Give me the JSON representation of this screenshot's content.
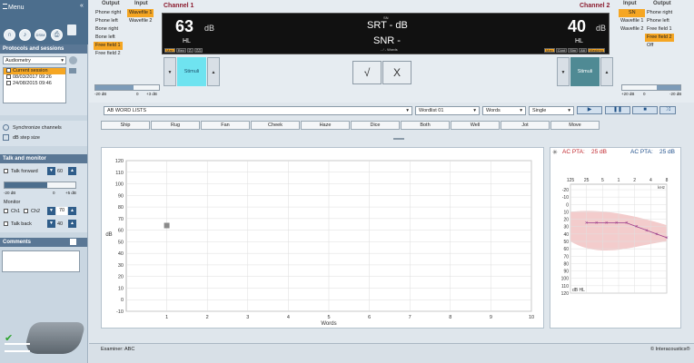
{
  "sidebar": {
    "menu_label": "Menu",
    "icons": [
      "headphones-icon",
      "note-icon",
      "dsim-icon",
      "print-icon"
    ],
    "icon_labels": [
      "",
      "♪",
      "DSIM",
      "⎙"
    ],
    "protocols_title": "Protocols and sessions",
    "protocol_value": "Audiometry",
    "sessions": [
      {
        "label": "Current session",
        "highlight": true
      },
      {
        "label": "08/03/2017 09:26",
        "highlight": false
      },
      {
        "label": "24/08/2015 09:46",
        "highlight": false
      }
    ],
    "sync_label": "Synchronize channels",
    "step_label": "dB step size",
    "talk_title": "Talk and monitor",
    "talk_forward": "Talk forward",
    "talk_forward_value": "60",
    "talk_scale": [
      "-20 dB",
      "0",
      "+5 dB"
    ],
    "monitor_label": "Monitor",
    "ch1_label": "Ch1",
    "ch2_label": "Ch2",
    "monitor_value": "70",
    "talk_back": "Talk back",
    "talk_back_value": "40",
    "comments_title": "Comments"
  },
  "channel1": {
    "title": "Channel 1",
    "output_label": "Output",
    "input_label": "Input",
    "outputs": [
      {
        "label": "Phone right",
        "active": false
      },
      {
        "label": "Phone left",
        "active": false
      },
      {
        "label": "Bone right",
        "active": false
      },
      {
        "label": "Bone left",
        "active": false
      },
      {
        "label": "Free field 1",
        "active": true
      },
      {
        "label": "Free field 2",
        "active": false
      }
    ],
    "inputs": [
      {
        "label": "Wavefile 1",
        "active": true
      },
      {
        "label": "Wavefile 2",
        "active": false
      }
    ],
    "level": "63",
    "unit": "dB",
    "sub": "HL",
    "stimuli_label": "Stimuli",
    "strip": [
      "Man",
      "Rev",
      "⎍",
      "⎍⎍"
    ],
    "slider_labels": [
      "-20 dB",
      "0",
      "+3 dB"
    ]
  },
  "channel2": {
    "title": "Channel 2",
    "input_label": "Input",
    "output_label": "Output",
    "inputs": [
      {
        "label": "SN",
        "active": true
      },
      {
        "label": "Wavefile 1",
        "active": false
      },
      {
        "label": "Wavefile 2",
        "active": false
      }
    ],
    "outputs": [
      {
        "label": "Phone right",
        "active": false
      },
      {
        "label": "Phone left",
        "active": false
      },
      {
        "label": "Free field 1",
        "active": false
      },
      {
        "label": "Free field 2",
        "active": true
      },
      {
        "label": "Off",
        "active": false
      }
    ],
    "level": "40",
    "unit": "dB",
    "sub": "HL",
    "stimuli_label": "Stimuli",
    "strip": [
      "Man",
      "Cont",
      "Sim",
      "Alt",
      "Masking"
    ],
    "slider_labels": [
      "+20 dB",
      "0",
      "-20 dB"
    ]
  },
  "center": {
    "sn_label": "SN",
    "srt_text": "SRT - dB",
    "snr_text": "SNR -",
    "words_label": "- / - Words",
    "correct_label": "√",
    "incorrect_label": "X"
  },
  "words": {
    "list_name": "AB WORD LISTS",
    "wordlist": "Wordlist 01",
    "mode": "Words",
    "presentation": "Single",
    "items": [
      "Ship",
      "Rug",
      "Fan",
      "Cheek",
      "Haze",
      "Dice",
      "Both",
      "Well",
      "Jot",
      "Move"
    ],
    "player_icons": [
      "play-icon",
      "pause-icon",
      "stop-icon",
      "shuffle-icon"
    ]
  },
  "chart_data": {
    "type": "scatter",
    "xlabel": "Words",
    "ylabel": "dB",
    "xlim": [
      0,
      10
    ],
    "ylim": [
      -10,
      120
    ],
    "x_ticks": [
      "1",
      "2",
      "3",
      "4",
      "5",
      "6",
      "7",
      "8",
      "9",
      "10"
    ],
    "y_ticks": [
      "120",
      "110",
      "100",
      "90",
      "80",
      "70",
      "60",
      "50",
      "40",
      "30",
      "20",
      "10",
      "0",
      "-10"
    ],
    "points": [
      {
        "x": 1,
        "y": 64
      }
    ],
    "marker_color": "#8a8a8a"
  },
  "audiogram": {
    "ac_left_label": "AC PTA:",
    "ac_left_value": "25 dB",
    "ac_right_label": "AC PTA:",
    "ac_right_value": "25 dB",
    "freq_labels": [
      "125",
      "25",
      "5",
      "1",
      "2",
      "4",
      "8"
    ],
    "khz_label": "kHz",
    "db_ticks": [
      "-20",
      "-10",
      "0",
      "10",
      "20",
      "30",
      "40",
      "50",
      "60",
      "70",
      "80",
      "90",
      "100",
      "110",
      "120"
    ],
    "hl_label": "dB HL",
    "curve_db": [
      25,
      25,
      25,
      25,
      25,
      30,
      35,
      40,
      45
    ],
    "speech_banana_color": "#f3cccc",
    "curve_color": "#9b3a8a"
  },
  "footer": {
    "examiner": "Examiner: ABC",
    "copyright": "© Interacoustics®"
  }
}
